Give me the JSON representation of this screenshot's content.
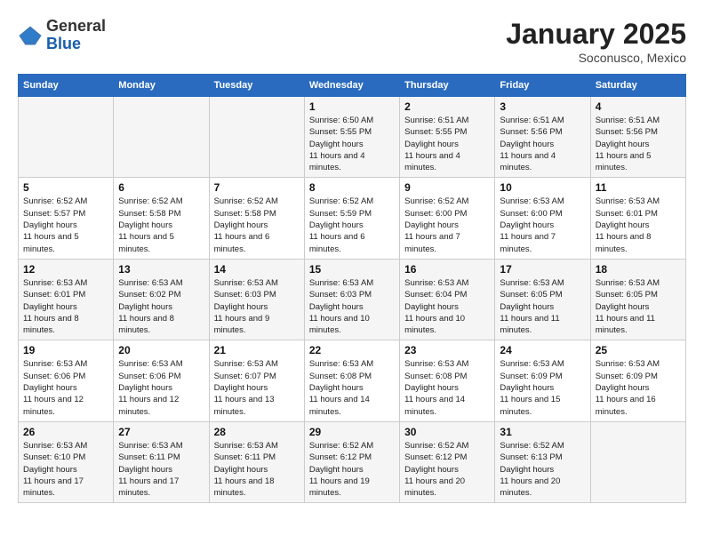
{
  "header": {
    "logo": {
      "general": "General",
      "blue": "Blue"
    },
    "title": "January 2025",
    "subtitle": "Soconusco, Mexico"
  },
  "weekdays": [
    "Sunday",
    "Monday",
    "Tuesday",
    "Wednesday",
    "Thursday",
    "Friday",
    "Saturday"
  ],
  "weeks": [
    [
      {
        "day": "",
        "info": ""
      },
      {
        "day": "",
        "info": ""
      },
      {
        "day": "",
        "info": ""
      },
      {
        "day": "1",
        "sunrise": "6:50 AM",
        "sunset": "5:55 PM",
        "daylight": "11 hours and 4 minutes."
      },
      {
        "day": "2",
        "sunrise": "6:51 AM",
        "sunset": "5:55 PM",
        "daylight": "11 hours and 4 minutes."
      },
      {
        "day": "3",
        "sunrise": "6:51 AM",
        "sunset": "5:56 PM",
        "daylight": "11 hours and 4 minutes."
      },
      {
        "day": "4",
        "sunrise": "6:51 AM",
        "sunset": "5:56 PM",
        "daylight": "11 hours and 5 minutes."
      }
    ],
    [
      {
        "day": "5",
        "sunrise": "6:52 AM",
        "sunset": "5:57 PM",
        "daylight": "11 hours and 5 minutes."
      },
      {
        "day": "6",
        "sunrise": "6:52 AM",
        "sunset": "5:58 PM",
        "daylight": "11 hours and 5 minutes."
      },
      {
        "day": "7",
        "sunrise": "6:52 AM",
        "sunset": "5:58 PM",
        "daylight": "11 hours and 6 minutes."
      },
      {
        "day": "8",
        "sunrise": "6:52 AM",
        "sunset": "5:59 PM",
        "daylight": "11 hours and 6 minutes."
      },
      {
        "day": "9",
        "sunrise": "6:52 AM",
        "sunset": "6:00 PM",
        "daylight": "11 hours and 7 minutes."
      },
      {
        "day": "10",
        "sunrise": "6:53 AM",
        "sunset": "6:00 PM",
        "daylight": "11 hours and 7 minutes."
      },
      {
        "day": "11",
        "sunrise": "6:53 AM",
        "sunset": "6:01 PM",
        "daylight": "11 hours and 8 minutes."
      }
    ],
    [
      {
        "day": "12",
        "sunrise": "6:53 AM",
        "sunset": "6:01 PM",
        "daylight": "11 hours and 8 minutes."
      },
      {
        "day": "13",
        "sunrise": "6:53 AM",
        "sunset": "6:02 PM",
        "daylight": "11 hours and 8 minutes."
      },
      {
        "day": "14",
        "sunrise": "6:53 AM",
        "sunset": "6:03 PM",
        "daylight": "11 hours and 9 minutes."
      },
      {
        "day": "15",
        "sunrise": "6:53 AM",
        "sunset": "6:03 PM",
        "daylight": "11 hours and 10 minutes."
      },
      {
        "day": "16",
        "sunrise": "6:53 AM",
        "sunset": "6:04 PM",
        "daylight": "11 hours and 10 minutes."
      },
      {
        "day": "17",
        "sunrise": "6:53 AM",
        "sunset": "6:05 PM",
        "daylight": "11 hours and 11 minutes."
      },
      {
        "day": "18",
        "sunrise": "6:53 AM",
        "sunset": "6:05 PM",
        "daylight": "11 hours and 11 minutes."
      }
    ],
    [
      {
        "day": "19",
        "sunrise": "6:53 AM",
        "sunset": "6:06 PM",
        "daylight": "11 hours and 12 minutes."
      },
      {
        "day": "20",
        "sunrise": "6:53 AM",
        "sunset": "6:06 PM",
        "daylight": "11 hours and 12 minutes."
      },
      {
        "day": "21",
        "sunrise": "6:53 AM",
        "sunset": "6:07 PM",
        "daylight": "11 hours and 13 minutes."
      },
      {
        "day": "22",
        "sunrise": "6:53 AM",
        "sunset": "6:08 PM",
        "daylight": "11 hours and 14 minutes."
      },
      {
        "day": "23",
        "sunrise": "6:53 AM",
        "sunset": "6:08 PM",
        "daylight": "11 hours and 14 minutes."
      },
      {
        "day": "24",
        "sunrise": "6:53 AM",
        "sunset": "6:09 PM",
        "daylight": "11 hours and 15 minutes."
      },
      {
        "day": "25",
        "sunrise": "6:53 AM",
        "sunset": "6:09 PM",
        "daylight": "11 hours and 16 minutes."
      }
    ],
    [
      {
        "day": "26",
        "sunrise": "6:53 AM",
        "sunset": "6:10 PM",
        "daylight": "11 hours and 17 minutes."
      },
      {
        "day": "27",
        "sunrise": "6:53 AM",
        "sunset": "6:11 PM",
        "daylight": "11 hours and 17 minutes."
      },
      {
        "day": "28",
        "sunrise": "6:53 AM",
        "sunset": "6:11 PM",
        "daylight": "11 hours and 18 minutes."
      },
      {
        "day": "29",
        "sunrise": "6:52 AM",
        "sunset": "6:12 PM",
        "daylight": "11 hours and 19 minutes."
      },
      {
        "day": "30",
        "sunrise": "6:52 AM",
        "sunset": "6:12 PM",
        "daylight": "11 hours and 20 minutes."
      },
      {
        "day": "31",
        "sunrise": "6:52 AM",
        "sunset": "6:13 PM",
        "daylight": "11 hours and 20 minutes."
      },
      {
        "day": "",
        "info": ""
      }
    ]
  ]
}
